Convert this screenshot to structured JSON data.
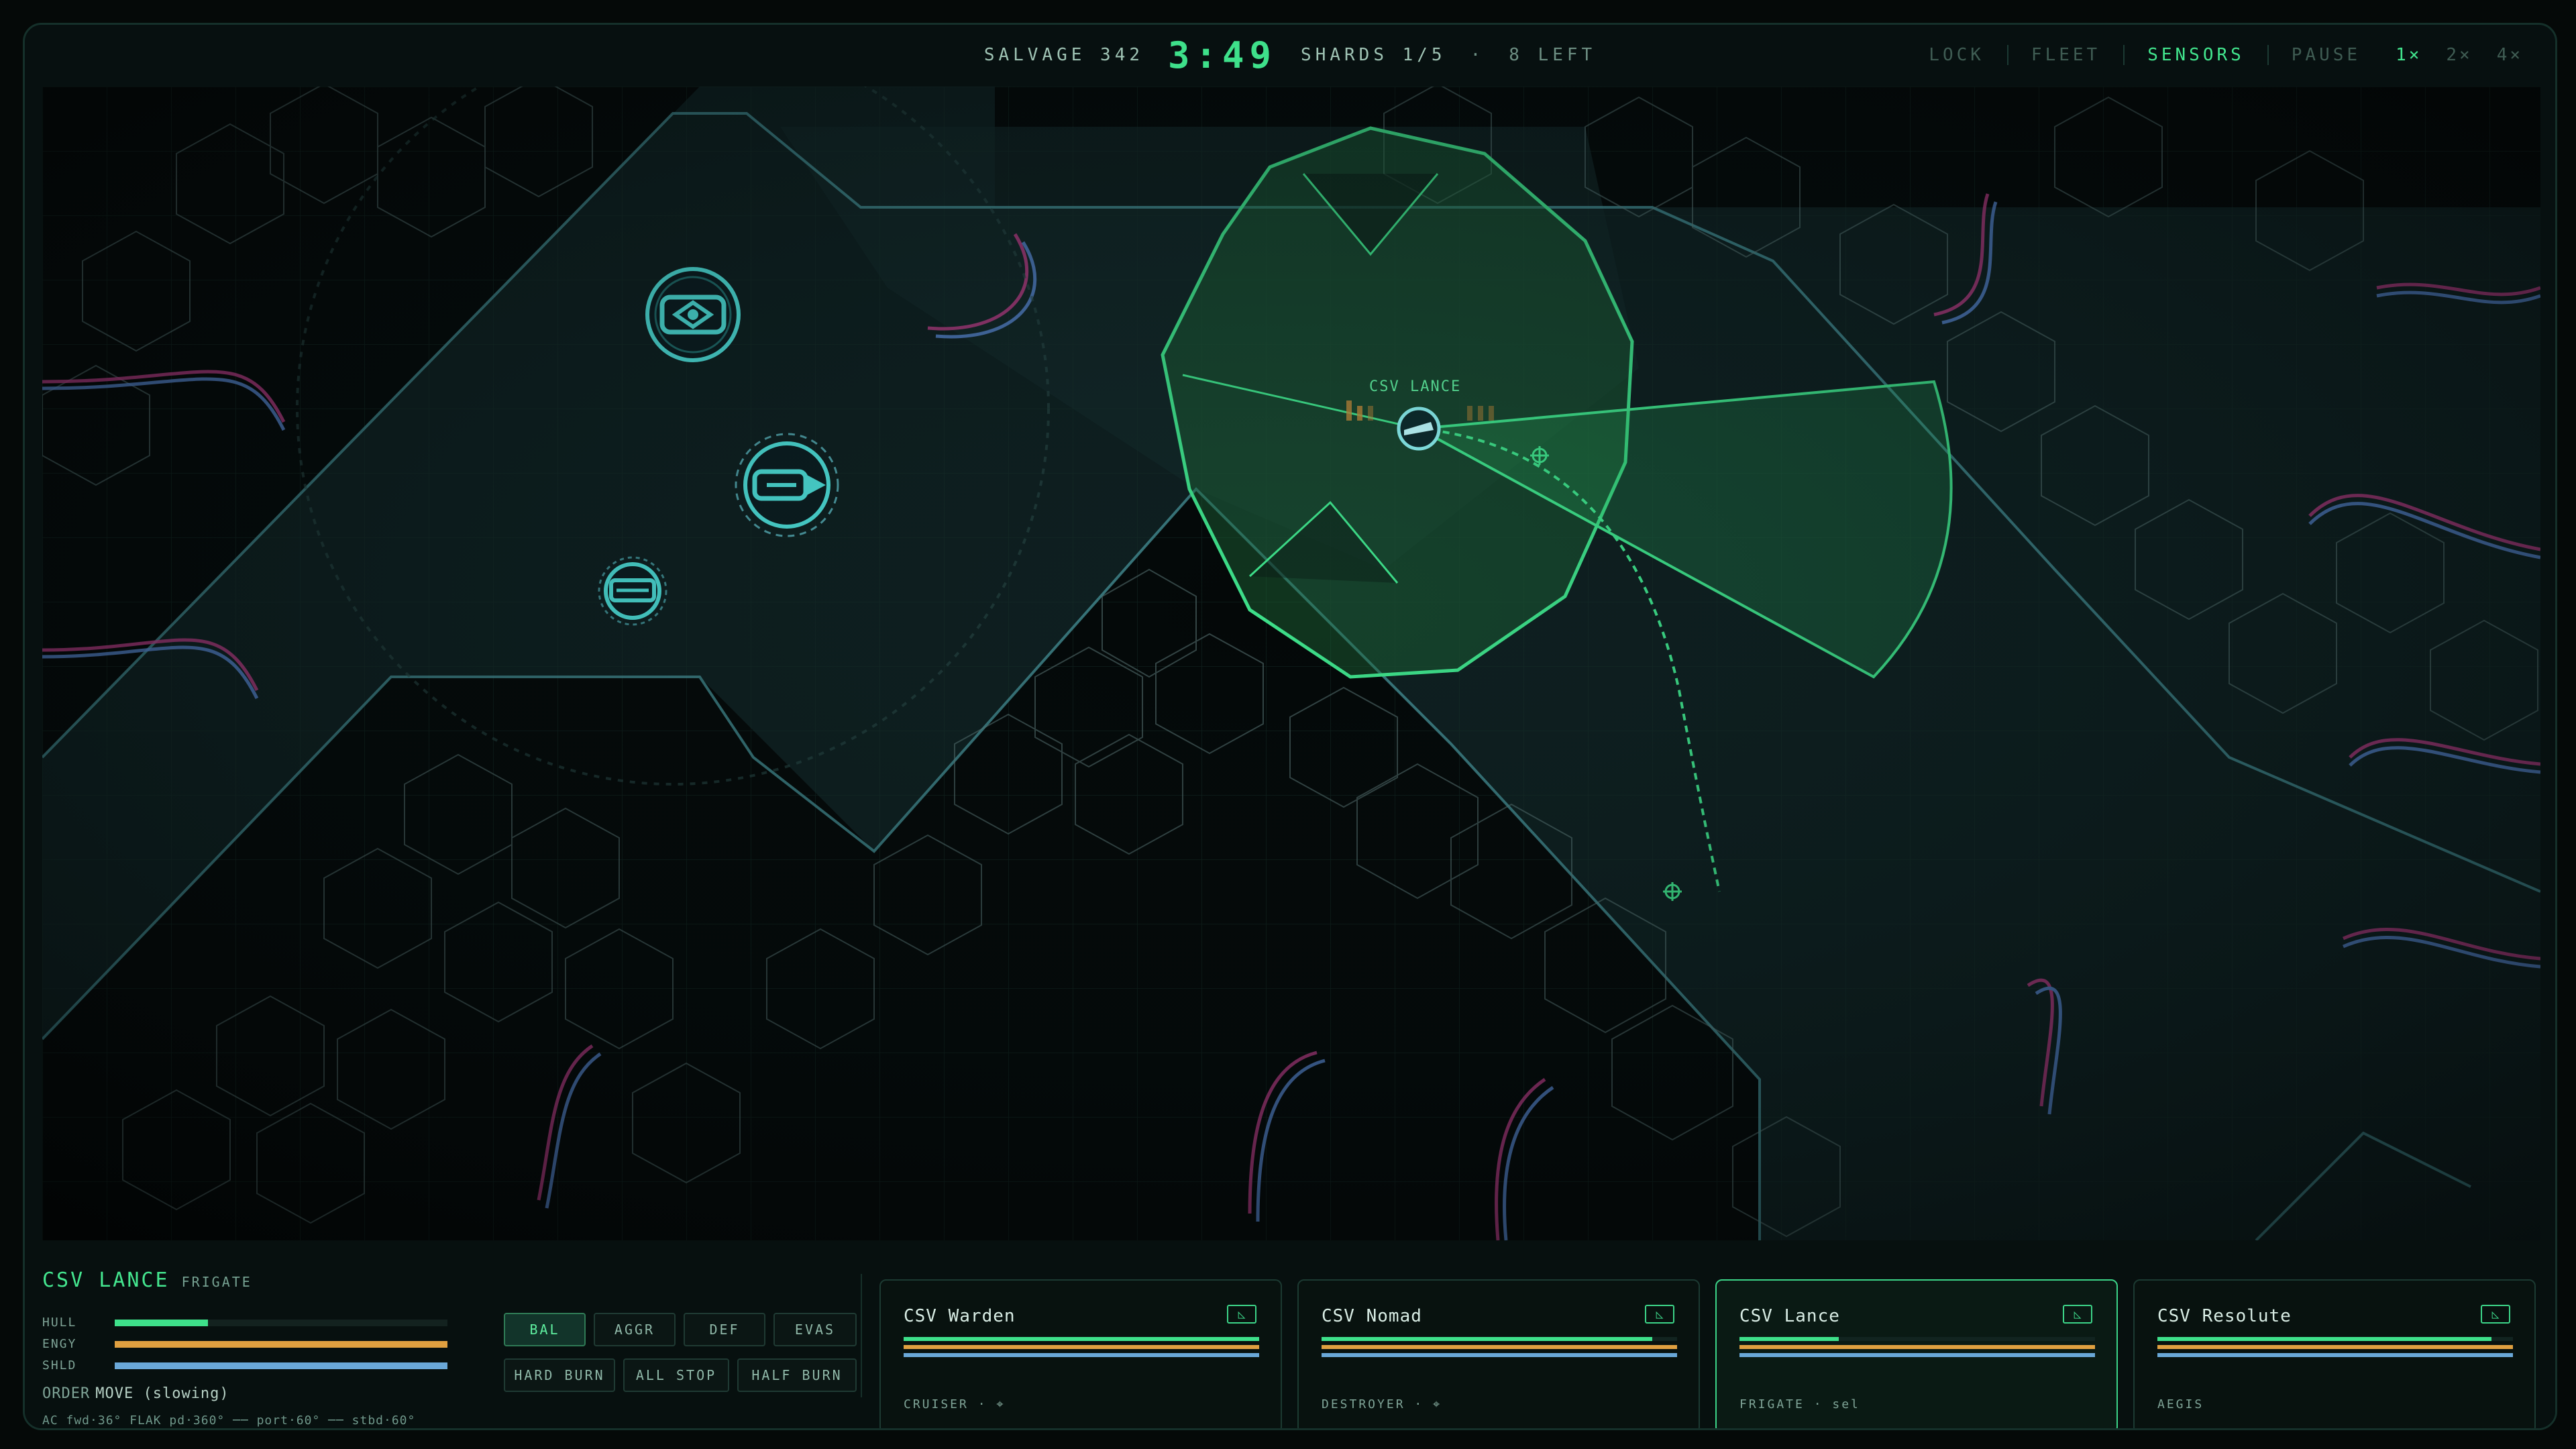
{
  "topbar": {
    "salvage": "SALVAGE 342",
    "clock": "3:49",
    "shards": "SHARDS 1/5",
    "dot": "·",
    "left": "8 LEFT",
    "modes": [
      "LOCK",
      "FLEET",
      "SENSORS"
    ],
    "active_mode": "SENSORS",
    "pause": "PAUSE",
    "speeds": [
      "1×",
      "2×",
      "4×"
    ],
    "active_speed": "1×"
  },
  "map": {
    "selected_label": "CSV LANCE",
    "sensor_color": "#3ee08a",
    "friendly_color": "#4fe6e0",
    "units": [
      {
        "name": "ally-unit",
        "icon": "eye-shield-icon"
      },
      {
        "name": "ally-unit",
        "icon": "cannon-ship-icon"
      },
      {
        "name": "ally-unit",
        "icon": "small-ship-icon"
      },
      {
        "name": "selected-unit",
        "icon": "frigate-icon"
      }
    ]
  },
  "selected": {
    "name": "CSV LANCE",
    "class": "FRIGATE",
    "stats": [
      {
        "label": "HULL",
        "value": 0.28,
        "color": "#3ee08a"
      },
      {
        "label": "ENGY",
        "value": 1.0,
        "color": "#e0a040"
      },
      {
        "label": "SHLD",
        "value": 1.0,
        "color": "#6aa8d8"
      }
    ],
    "order_key": "ORDER",
    "order_value": "MOVE (slowing)",
    "arcs": "AC fwd·36° FLAK pd·360° ── port·60° ── stbd·60°"
  },
  "stances": {
    "row1": [
      "BAL",
      "AGGR",
      "DEF",
      "EVAS"
    ],
    "active": "BAL",
    "row2": [
      "HARD BURN",
      "ALL STOP",
      "HALF BURN"
    ]
  },
  "fleet": [
    {
      "name": "CSV Warden",
      "meta": "CRUISER · ⌖",
      "hull": 1.0,
      "engy": 1.0,
      "shld": 1.0,
      "selected": false
    },
    {
      "name": "CSV Nomad",
      "meta": "DESTROYER · ⌖",
      "hull": 0.93,
      "engy": 1.0,
      "shld": 1.0,
      "selected": false
    },
    {
      "name": "CSV Lance",
      "meta": "FRIGATE · sel",
      "hull": 0.28,
      "engy": 1.0,
      "shld": 1.0,
      "selected": true
    },
    {
      "name": "CSV Resolute",
      "meta": "AEGIS",
      "hull": 0.94,
      "engy": 1.0,
      "shld": 1.0,
      "selected": false
    }
  ],
  "colors": {
    "hull": "#3ee08a",
    "engy": "#e0a040",
    "shld": "#6aa8d8"
  }
}
